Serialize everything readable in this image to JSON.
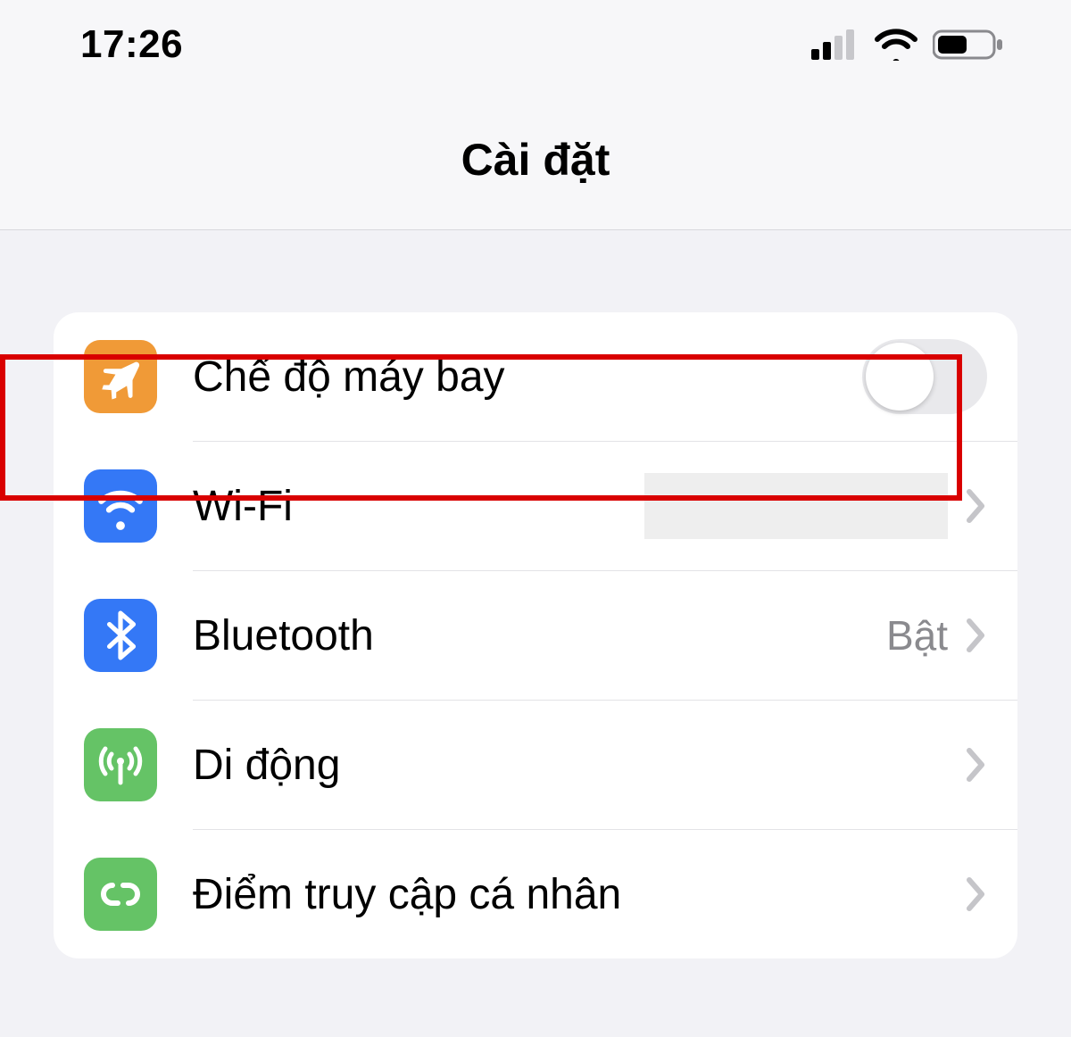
{
  "status_bar": {
    "time": "17:26"
  },
  "header": {
    "title": "Cài đặt"
  },
  "rows": {
    "airplane": {
      "label": "Chế độ máy bay"
    },
    "wifi": {
      "label": "Wi-Fi",
      "value": ""
    },
    "bluetooth": {
      "label": "Bluetooth",
      "value": "Bật"
    },
    "cellular": {
      "label": "Di động"
    },
    "hotspot": {
      "label": "Điểm truy cập cá nhân"
    }
  }
}
